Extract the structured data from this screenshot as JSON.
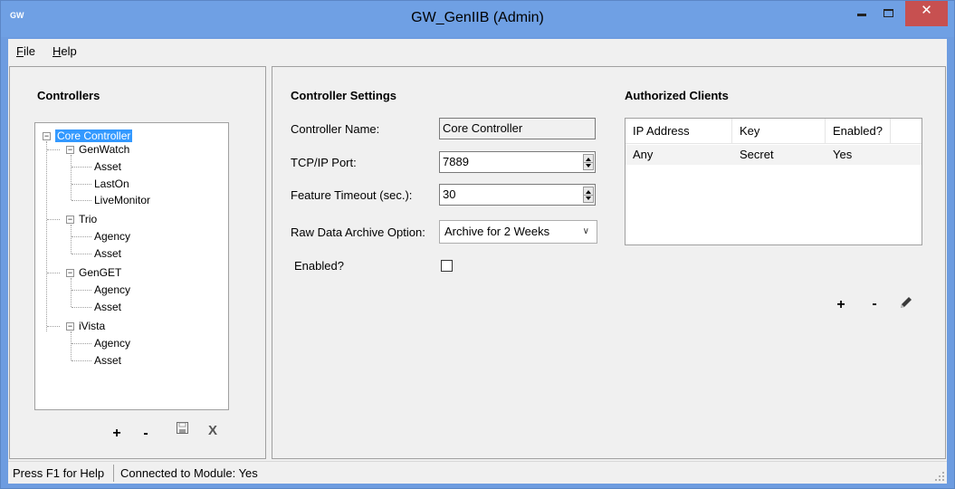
{
  "window": {
    "title": "GW_GenIIB (Admin)",
    "app_icon_text": "GW",
    "close_label": "✕"
  },
  "menu": {
    "file": {
      "accel": "F",
      "rest": "ile"
    },
    "help": {
      "accel": "H",
      "rest": "elp"
    }
  },
  "controllers": {
    "title": "Controllers",
    "tree": {
      "root": "Core Controller",
      "groups": [
        {
          "label": "GenWatch",
          "children": [
            "Asset",
            "LastOn",
            "LiveMonitor"
          ]
        },
        {
          "label": "Trio",
          "children": [
            "Agency",
            "Asset"
          ]
        },
        {
          "label": "GenGET",
          "children": [
            "Agency",
            "Asset"
          ]
        },
        {
          "label": "iVista",
          "children": [
            "Agency",
            "Asset"
          ]
        }
      ]
    },
    "toolbar": {
      "add": "+",
      "remove": "-",
      "save_icon": "save-icon",
      "delete": "X"
    }
  },
  "settings": {
    "title": "Controller Settings",
    "controller_name_label": "Controller Name:",
    "controller_name_value": "Core Controller",
    "tcp_port_label": "TCP/IP Port:",
    "tcp_port_value": "7889",
    "feature_timeout_label": "Feature Timeout (sec.):",
    "feature_timeout_value": "30",
    "archive_label": "Raw Data Archive Option:",
    "archive_value": "Archive for 2 Weeks",
    "enabled_label": "Enabled?",
    "enabled_checked": false
  },
  "clients": {
    "title": "Authorized Clients",
    "columns": [
      "IP Address",
      "Key",
      "Enabled?"
    ],
    "rows": [
      [
        "Any",
        "Secret",
        "Yes"
      ]
    ],
    "toolbar": {
      "add": "+",
      "remove": "-",
      "edit_icon": "pencil-icon"
    }
  },
  "status": {
    "help": "Press F1 for Help",
    "connection": "Connected to Module: Yes"
  },
  "colors": {
    "titlebar": "#6fa0e4",
    "close": "#c75050",
    "selection": "#3399ff"
  }
}
